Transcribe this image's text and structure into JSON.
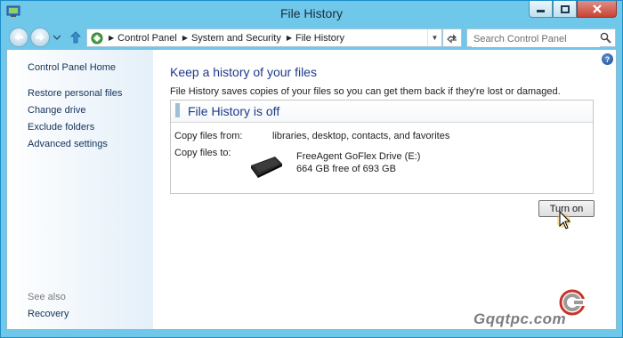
{
  "window": {
    "title": "File History",
    "controls": [
      "minimize",
      "maximize",
      "close"
    ]
  },
  "navigation": {
    "breadcrumb": [
      "Control Panel",
      "System and Security",
      "File History"
    ],
    "search_placeholder": "Search Control Panel"
  },
  "sidebar": {
    "home_link": "Control Panel Home",
    "links": [
      "Restore personal files",
      "Change drive",
      "Exclude folders",
      "Advanced settings"
    ],
    "see_also_label": "See also",
    "see_also_links": [
      "Recovery"
    ]
  },
  "main": {
    "heading": "Keep a history of your files",
    "description": "File History saves copies of your files so you can get them back if they're lost or damaged.",
    "status_title": "File History is off",
    "copy_from_label": "Copy files from:",
    "copy_from_value": "libraries, desktop, contacts, and favorites",
    "copy_to_label": "Copy files to:",
    "drive_name": "FreeAgent GoFlex Drive (E:)",
    "drive_space": "664 GB free of 693 GB",
    "turn_on_button": "Turn on"
  },
  "watermark": {
    "text": "Gqqtpc.com"
  },
  "colors": {
    "titlebar": "#6fc7ea",
    "link": "#14325a",
    "heading": "#1e3a8a"
  },
  "icons": [
    "control-panel-icon",
    "back-arrow-icon",
    "forward-arrow-icon",
    "up-arrow-icon",
    "refresh-icon",
    "search-icon",
    "help-icon",
    "external-drive-icon",
    "mouse-cursor-icon"
  ]
}
